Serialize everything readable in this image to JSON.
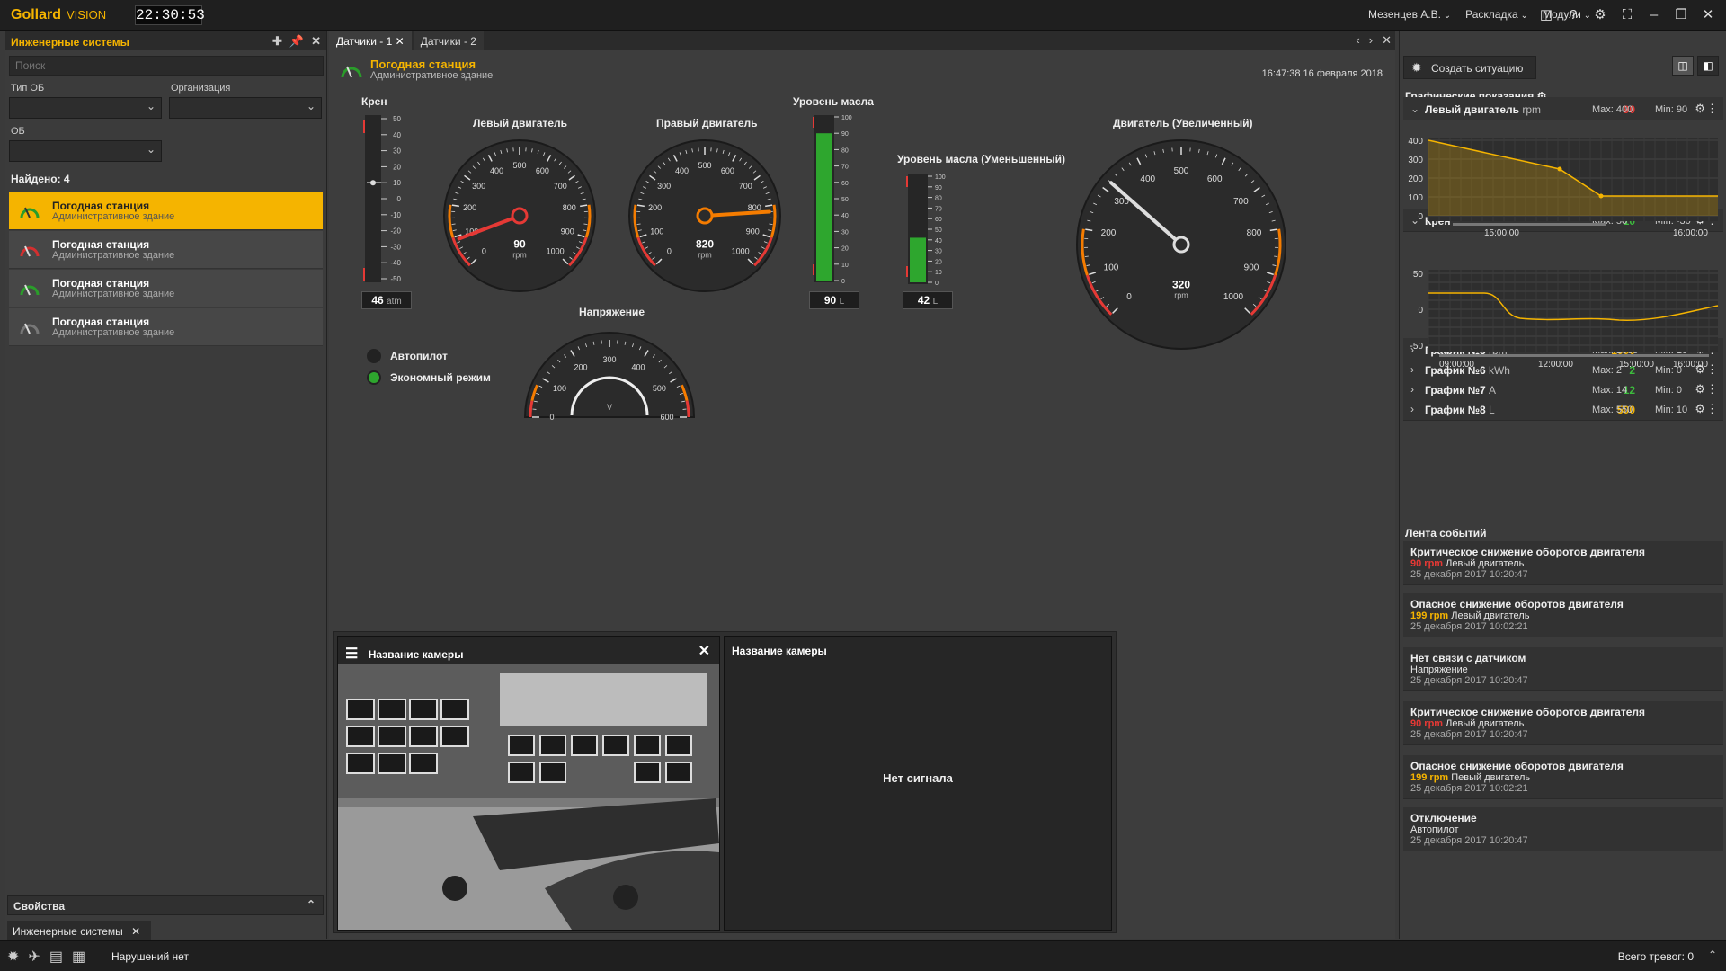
{
  "app": {
    "logo": "Gollard",
    "logo_sub": "VISION",
    "clock": "22:30:53"
  },
  "top_menu": {
    "user": "Мезенцев А.В.",
    "layout": "Раскладка",
    "modules": "Модули"
  },
  "left_panel": {
    "title": "Инженерные системы",
    "search_placeholder": "Поиск",
    "filter_type_label": "Тип ОБ",
    "filter_org_label": "Организация",
    "filter_ob_label": "ОБ",
    "found": "Найдено: 4",
    "items": [
      {
        "title": "Погодная станция",
        "subtitle": "Административное здание",
        "status_color": "#2a9d2a"
      },
      {
        "title": "Погодная станция",
        "subtitle": "Административное здание",
        "status_color": "#d32f2f"
      },
      {
        "title": "Погодная станция",
        "subtitle": "Административное здание",
        "status_color": "#2a9d2a"
      },
      {
        "title": "Погодная станция",
        "subtitle": "Административное здание",
        "status_color": "#777777"
      }
    ],
    "properties": "Свойства",
    "bottom_tab": "Инженерные системы"
  },
  "tabs": [
    {
      "label": "Датчики - 1"
    },
    {
      "label": "Датчики - 2"
    }
  ],
  "station": {
    "title": "Погодная станция",
    "subtitle": "Административное здание",
    "datetime": "16:47:38  16 февраля 2018"
  },
  "widgets": {
    "kren": {
      "label": "Крен",
      "value": "46",
      "unit": "atm",
      "ticks": [
        "50",
        "40",
        "30",
        "20",
        "10",
        "0",
        "-10",
        "-20",
        "-30",
        "-40",
        "-50"
      ],
      "pointer": 10
    },
    "left_engine": {
      "label": "Левый двигатель",
      "value": "90",
      "unit": "rpm",
      "needle_value": 90
    },
    "right_engine": {
      "label": "Правый двигатель",
      "value": "820",
      "unit": "rpm",
      "needle_value": 820
    },
    "oil": {
      "label": "Уровень масла",
      "value": "90",
      "unit": "L",
      "level": 90,
      "ticks": [
        "100",
        "90",
        "80",
        "70",
        "60",
        "50",
        "40",
        "30",
        "20",
        "10",
        "0"
      ]
    },
    "oil_small": {
      "label": "Уровень масла (Уменьшенный)",
      "value": "42",
      "unit": "L",
      "level": 42,
      "ticks": [
        "100",
        "90",
        "80",
        "70",
        "60",
        "50",
        "40",
        "30",
        "20",
        "10",
        "0"
      ]
    },
    "engine_big": {
      "label": "Двигатель (Увеличенный)",
      "value": "320",
      "unit": "rpm",
      "needle_value": 320
    },
    "voltage": {
      "label": "Напряжение",
      "unit": "V",
      "ticks": [
        "0",
        "100",
        "200",
        "300",
        "400",
        "500",
        "600"
      ]
    },
    "autopilot": {
      "label": "Автопилот",
      "color": "#222222"
    },
    "eco": {
      "label": "Экономный режим",
      "color": "#2ea62e"
    }
  },
  "gauge_ticks": [
    "0",
    "100",
    "200",
    "300",
    "400",
    "500",
    "600",
    "700",
    "800",
    "900",
    "1000"
  ],
  "cameras": [
    {
      "title": "Название камеры",
      "status": ""
    },
    {
      "title": "Название камеры",
      "status": "Нет сигнала"
    }
  ],
  "right_panel": {
    "create_button": "Создать ситуацию",
    "graphs_title": "Графические показания",
    "graphs": [
      {
        "name": "Левый двигатель",
        "unit": "rpm",
        "value": "90",
        "value_color": "#e53935",
        "max": "Max: 400",
        "min": "Min: 90",
        "expanded": true
      },
      {
        "name": "Крен",
        "unit": "°",
        "value": "10",
        "value_color": "#3dbb3d",
        "max": "Max: 50",
        "min": "Min: -30",
        "expanded": true
      },
      {
        "name": "График №5",
        "unit": "rpm",
        "value": "1000",
        "value_color": "#f5b400",
        "max": "Max: 1000",
        "min": "Min: 10",
        "expanded": false
      },
      {
        "name": "График №6",
        "unit": "kWh",
        "value": "2",
        "value_color": "#3dbb3d",
        "max": "Max: 2",
        "min": "Min: 0",
        "expanded": false
      },
      {
        "name": "График №7",
        "unit": "A",
        "value": "12",
        "value_color": "#3dbb3d",
        "max": "Max: 14",
        "min": "Min: 0",
        "expanded": false
      },
      {
        "name": "График №8",
        "unit": "L",
        "value": "500",
        "value_color": "#f5b400",
        "max": "Max: 550",
        "min": "Min: 10",
        "expanded": false
      }
    ],
    "chart1": {
      "y_ticks": [
        "400",
        "300",
        "200",
        "100",
        "0"
      ],
      "x_ticks": [
        "15:00:00",
        "16:00:00"
      ]
    },
    "chart2": {
      "y_ticks": [
        "50",
        "0",
        "-50"
      ],
      "x_ticks": [
        "09:00:00",
        "12:00:00",
        "15:00:00",
        "16:00:00"
      ]
    },
    "events_title": "Лента событий",
    "events": [
      {
        "title": "Критическое снижение оборотов двигателя",
        "value": "90 rpm",
        "value_color": "#e53935",
        "source": "Левый двигатель",
        "date": "25 декабря 2017  10:20:47"
      },
      {
        "title": "Опасное снижение оборотов двигателя",
        "value": "199 rpm",
        "value_color": "#f5b400",
        "source": "Левый двигатель",
        "date": "25 декабря 2017  10:02:21"
      },
      {
        "title": "Нет связи с датчиком",
        "value": "",
        "value_color": "#e6e6e6",
        "source": "Напряжение",
        "date": "25 декабря 2017  10:20:47"
      },
      {
        "title": "Критическое снижение оборотов двигателя",
        "value": "90 rpm",
        "value_color": "#e53935",
        "source": "Левый двигатель",
        "date": "25 декабря 2017  10:20:47"
      },
      {
        "title": "Опасное снижение оборотов двигателя",
        "value": "199 rpm",
        "value_color": "#f5b400",
        "source": "Певый двигатель",
        "date": "25 декабря 2017  10:02:21"
      },
      {
        "title": "Отключение",
        "value": "",
        "value_color": "#e6e6e6",
        "source": "Автопилот",
        "date": "25 декабря 2017  10:20:47"
      }
    ]
  },
  "status_bar": {
    "violations": "Нарушений нет",
    "alarms": "Всего тревог: 0"
  }
}
